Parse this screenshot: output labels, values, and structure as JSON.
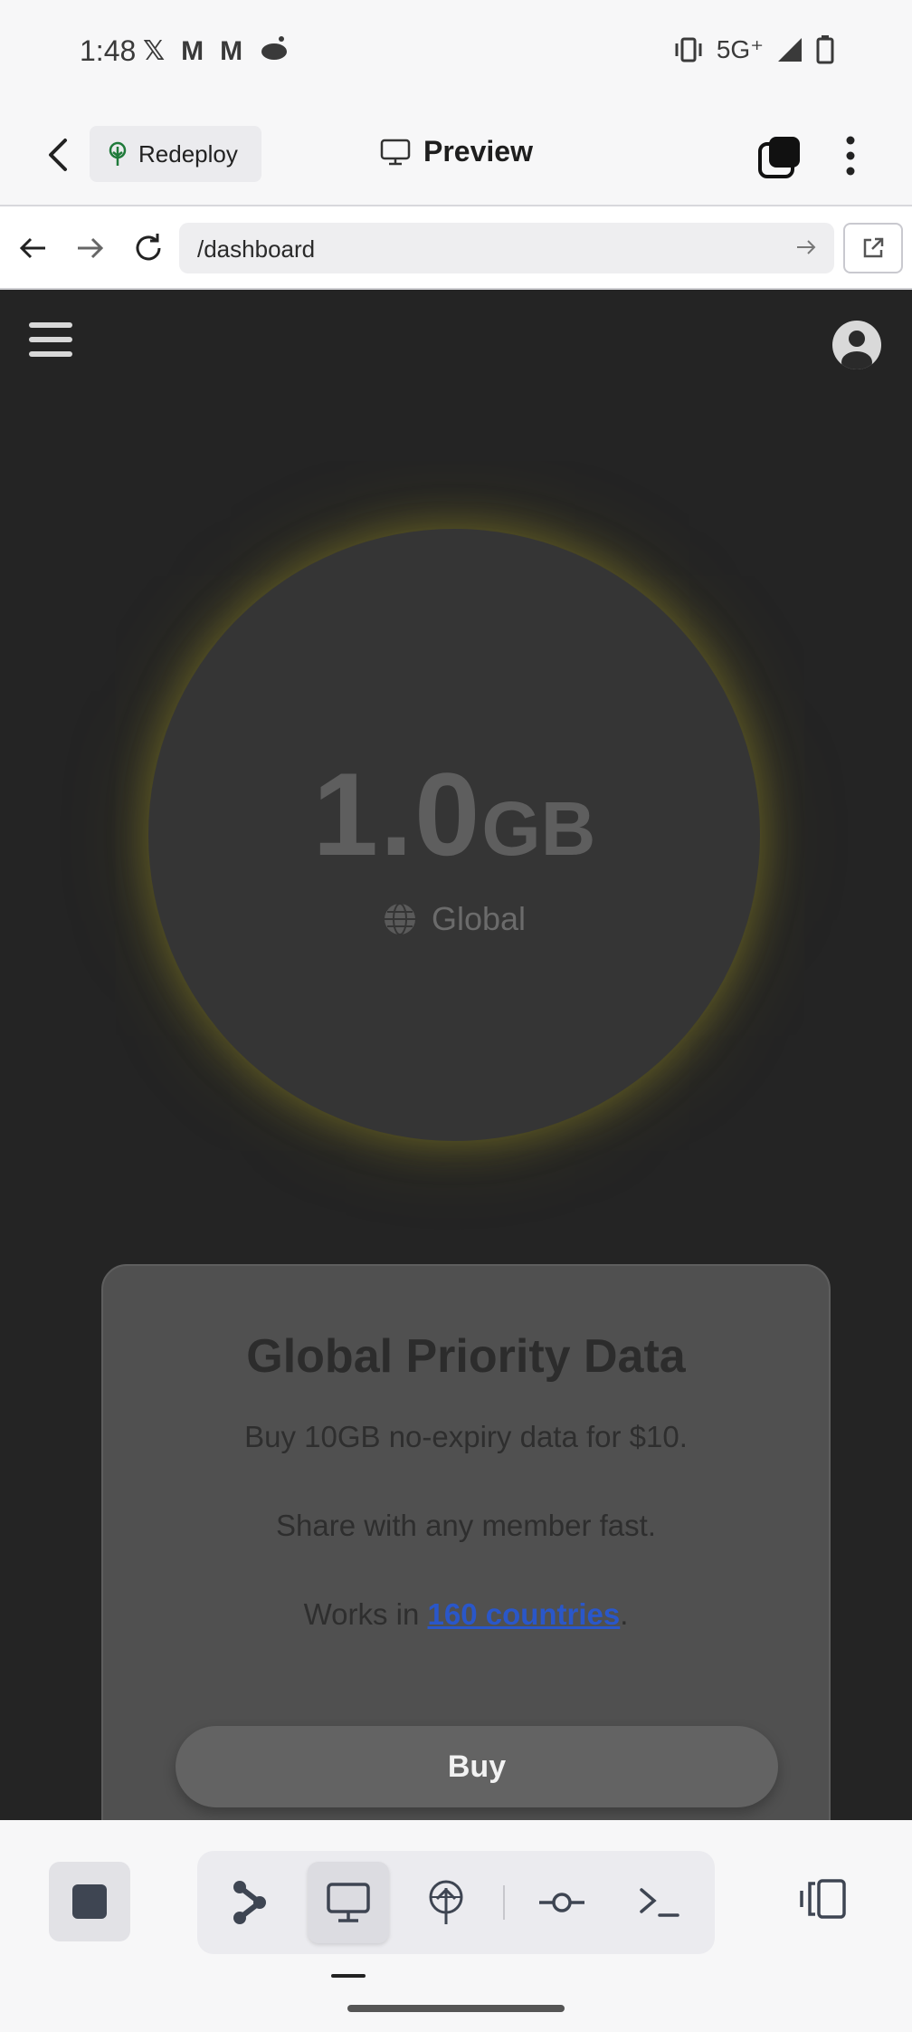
{
  "status_bar": {
    "time": "1:48",
    "notification_icons": [
      "x-icon",
      "gmail-icon",
      "gmail-icon",
      "reddit-icon"
    ],
    "network": "5G⁺"
  },
  "header": {
    "redeploy_label": "Redeploy",
    "title": "Preview"
  },
  "browser": {
    "url": "/dashboard"
  },
  "page": {
    "data_amount": "1.0",
    "data_unit": "GB",
    "region": "Global",
    "offer": {
      "title": "Global Priority Data",
      "line1": "Buy 10GB no-expiry data for $10.",
      "line2": "Share with any member fast.",
      "line3_prefix": "Works in ",
      "line3_link": "160 countries",
      "line3_suffix": ".",
      "buy_label": "Buy"
    }
  },
  "colors": {
    "page_background": "#242424",
    "circle": "#353535",
    "glow": "#b4aa28",
    "link": "#2a57c9"
  }
}
